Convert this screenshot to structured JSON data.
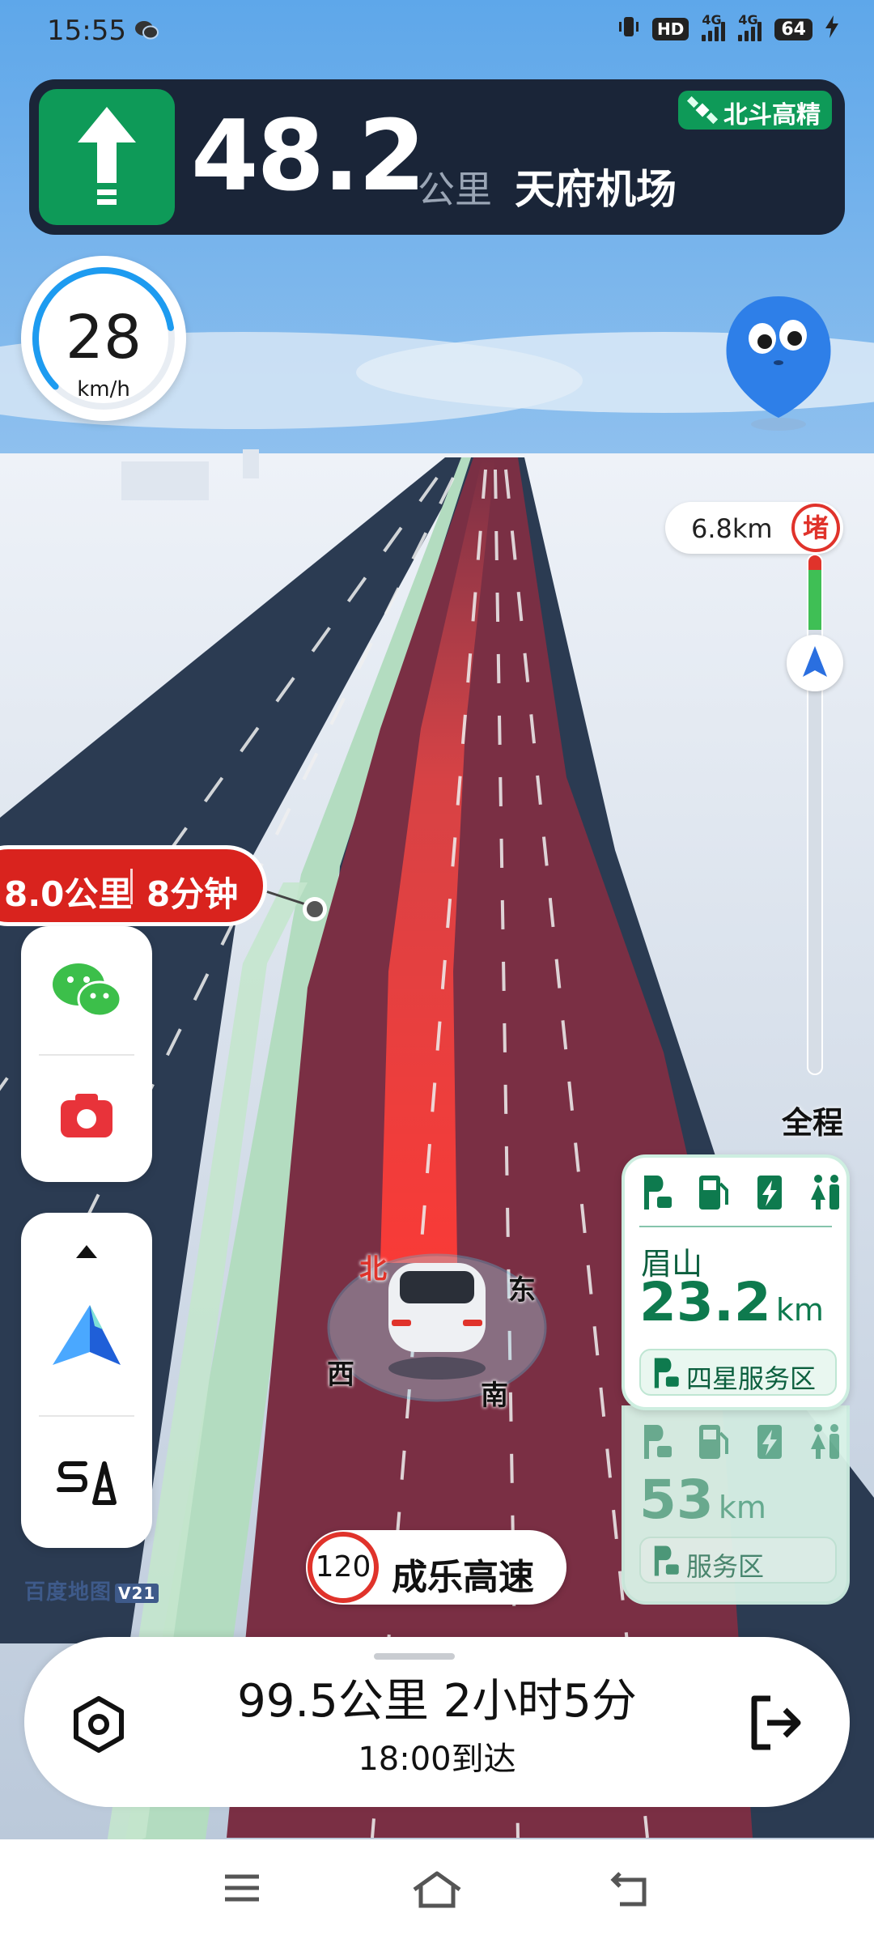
{
  "status_bar": {
    "time": "15:55",
    "hd": "HD",
    "signal1": "4G",
    "signal2": "4G",
    "battery": "64",
    "icons": [
      "wechat-icon",
      "vibrate-icon",
      "charging-icon"
    ]
  },
  "guidance": {
    "direction": "straight",
    "distance": "48.2",
    "unit": "公里",
    "destination": "天府机场",
    "positioning_badge": "北斗高精"
  },
  "speed": {
    "value": "28",
    "unit": "km/h",
    "gauge_fraction": 0.3
  },
  "traffic": {
    "jam_distance": "6.8km",
    "jam_label": "堵",
    "full_route_label": "全程"
  },
  "remaining_pill": {
    "distance": "8.0公里",
    "time": "8分钟"
  },
  "compass": {
    "north": "北",
    "east": "东",
    "west": "西",
    "south": "南"
  },
  "left_buttons": {
    "items": [
      "wechat-share-icon",
      "camera-icon",
      "collapse-up-icon",
      "navigation-arrow-icon",
      "route-settings-icon"
    ]
  },
  "brand": {
    "name": "百度地图",
    "version": "V21"
  },
  "road": {
    "speed_limit": "120",
    "name": "成乐高速"
  },
  "service_areas": [
    {
      "name": "眉山",
      "distance": "23.2",
      "unit": "km",
      "type": "四星服务区",
      "facilities": [
        "parking-icon",
        "fuel-icon",
        "charging-station-icon",
        "restroom-icon"
      ]
    },
    {
      "name": "",
      "distance": "53",
      "unit": "km",
      "type": "服务区",
      "facilities": [
        "parking-icon",
        "fuel-icon",
        "charging-station-icon",
        "restroom-icon"
      ]
    }
  ],
  "trip_summary": {
    "remaining": "99.5公里 2小时5分",
    "arrival": "18:00到达"
  },
  "colors": {
    "route_red": "#d9231e",
    "guidance_green": "#0e9a58",
    "banner_dark": "#1a2538",
    "service_green": "#0e7a4e"
  }
}
